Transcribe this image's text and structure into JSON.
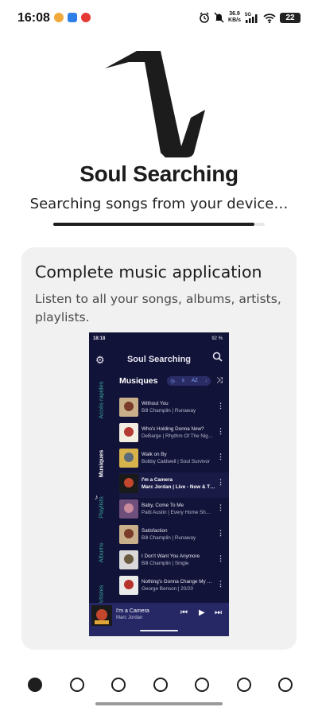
{
  "status": {
    "time": "16:08",
    "speed_value": "36.9",
    "speed_unit": "KB/s",
    "network": "5G",
    "battery": "22"
  },
  "app": {
    "title": "Soul Searching",
    "subtitle": "Searching songs from your device…",
    "progress": 0.95
  },
  "card": {
    "title": "Complete music application",
    "description": "Listen to all your songs, albums, artists, playlists."
  },
  "phone": {
    "status_time": "18:18",
    "status_right": "92 %",
    "header_title": "Soul Searching",
    "tabs": [
      "Accès rapides",
      "Musiques",
      "Playlists",
      "Albums",
      "Artistes"
    ],
    "list_title": "Musiques",
    "sort_label": "AZ",
    "songs": [
      {
        "title": "Without You",
        "sub": "Bill Champlin | Runaway",
        "colors": [
          "#c9b08a",
          "#7a3b2a"
        ]
      },
      {
        "title": "Who's Holding Donna Now?",
        "sub": "DeBarge | Rhythm Of The Nig…",
        "colors": [
          "#f4ede2",
          "#b53a34"
        ]
      },
      {
        "title": "Walk on By",
        "sub": "Bobby Caldwell | Soul Survivor",
        "colors": [
          "#d8b24a",
          "#5c6b79"
        ]
      },
      {
        "title": "I'm a Camera",
        "sub": "Marc Jordan | Live - Now & T…",
        "colors": [
          "#1a1a1a",
          "#c4472d"
        ]
      },
      {
        "title": "Baby, Come To Me",
        "sub": "Patti Austin | Every Home Sh…",
        "colors": [
          "#6e4f7c",
          "#c98a9c"
        ]
      },
      {
        "title": "Satisfaction",
        "sub": "Bill Champlin | Runaway",
        "colors": [
          "#c9b08a",
          "#7a3b2a"
        ]
      },
      {
        "title": "I Don't Want You Anymore",
        "sub": "Bill Champlin | Single",
        "colors": [
          "#d9d9d9",
          "#6a5a3e"
        ]
      },
      {
        "title": "Nothing's Gonna Change My …",
        "sub": "George Benson | 20/20",
        "colors": [
          "#ebebeb",
          "#b8322c"
        ]
      }
    ],
    "mini_player": {
      "title": "I'm a Camera",
      "artist": "Marc Jordan"
    }
  },
  "pager": {
    "count": 7,
    "active": 1
  }
}
